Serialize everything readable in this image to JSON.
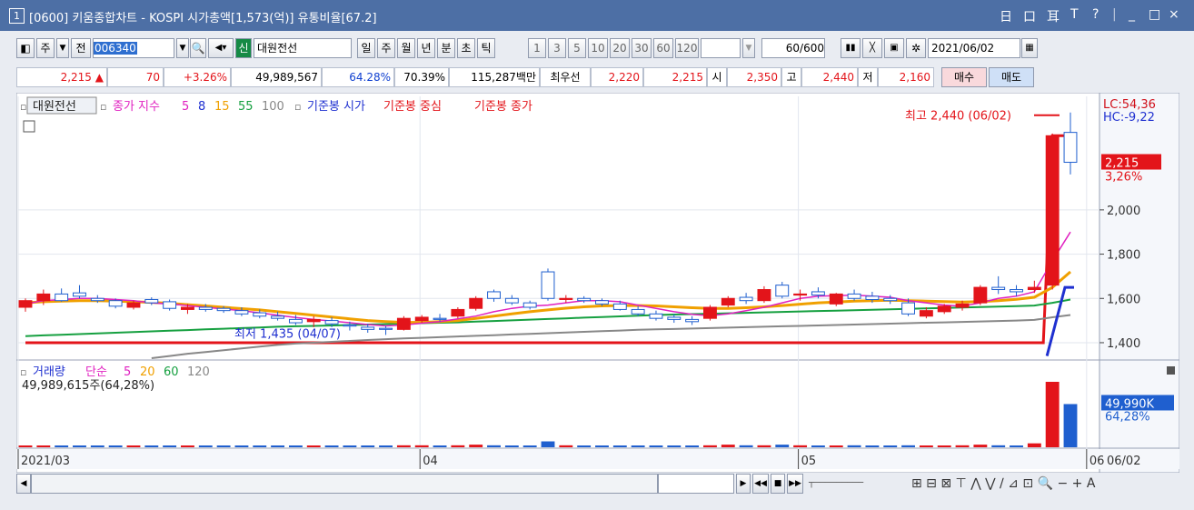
{
  "window": {
    "number": "1",
    "title": "[0600] 키움종합차트 - KOSPI 시가총액[1,573(억)] 유통비율[67.2]",
    "controls": [
      "日",
      "口",
      "耳",
      "T",
      "?",
      "|",
      "_",
      "□",
      "×"
    ]
  },
  "toolbar": {
    "market": "주",
    "prev": "전",
    "code": "006340",
    "new_badge": "신",
    "stock_name": "대원전선",
    "periods": [
      "일",
      "주",
      "월",
      "년",
      "분",
      "초",
      "틱"
    ],
    "active_period": "일",
    "intervals": [
      "1",
      "3",
      "5",
      "10",
      "20",
      "30",
      "60",
      "120"
    ],
    "count": "60",
    "total": "/600",
    "date": "2021/06/02"
  },
  "quote": {
    "price": "2,215",
    "up_mark": "▲",
    "change": "70",
    "change_pct": "+3.26%",
    "volume": "49,989,567",
    "vol_ratio": "64.28%",
    "turnover": "70.39%",
    "amount": "115,287백만",
    "bid_label": "최우선",
    "ask": "2,220",
    "bid": "2,215",
    "open_label": "시",
    "open": "2,350",
    "high_label": "고",
    "high": "2,440",
    "low_label": "저",
    "low": "2,160",
    "buy": "매수",
    "sell": "매도"
  },
  "legend": {
    "stock": "대원전선",
    "ma_label": "종가 지수",
    "ma_periods": [
      "5",
      "8",
      "15",
      "55",
      "100"
    ],
    "ref_open": "기준봉 시가",
    "ref_mid": "기준봉 중심",
    "ref_close": "기준봉 종가"
  },
  "vol_legend": {
    "label": "거래량",
    "type": "단순",
    "periods": [
      "5",
      "20",
      "60",
      "120"
    ],
    "value": "49,989,615주(64,28%)"
  },
  "annotations": {
    "high": "최고 2,440 (06/02)",
    "low": "최저 1,435 (04/07)"
  },
  "axis_right": {
    "lc": "LC:54,36",
    "hc": "HC:-9,22",
    "price_box": "2,215",
    "price_pct": "3,26%",
    "vol_box": "49,990K",
    "vol_pct": "64,28%"
  },
  "colors": {
    "up": "#e3141a",
    "down": "#1f5fcf",
    "ma5": "#e020c0",
    "ma8": "#1f30d0",
    "ma15": "#f0a000",
    "ma55": "#16a040",
    "ma100": "#888888",
    "ref_open": "#1f30d0",
    "ref_mid": "#e3141a",
    "ref_close": "#e3141a"
  },
  "chart_data": {
    "type": "candlestick",
    "y_ticks": [
      1400,
      1600,
      1800,
      2000
    ],
    "y_tick_labels": [
      "1,400",
      "1,600",
      "1,800",
      "2,000"
    ],
    "ylim": [
      1330,
      2480
    ],
    "x_labels": [
      {
        "label": "2021/03",
        "index": 0
      },
      {
        "label": "04",
        "index": 22
      },
      {
        "label": "05",
        "index": 43
      },
      {
        "label": "06",
        "index": 59
      }
    ],
    "last_date_label": "06/02",
    "candles": [
      [
        1560,
        1600,
        1540,
        1590
      ],
      [
        1590,
        1640,
        1570,
        1620
      ],
      [
        1620,
        1645,
        1585,
        1590
      ],
      [
        1625,
        1660,
        1600,
        1610
      ],
      [
        1600,
        1615,
        1580,
        1590
      ],
      [
        1590,
        1600,
        1555,
        1565
      ],
      [
        1560,
        1590,
        1550,
        1580
      ],
      [
        1595,
        1605,
        1570,
        1580
      ],
      [
        1585,
        1595,
        1545,
        1555
      ],
      [
        1550,
        1575,
        1530,
        1560
      ],
      [
        1560,
        1575,
        1540,
        1550
      ],
      [
        1555,
        1565,
        1535,
        1545
      ],
      [
        1545,
        1560,
        1520,
        1530
      ],
      [
        1535,
        1550,
        1510,
        1520
      ],
      [
        1520,
        1540,
        1500,
        1510
      ],
      [
        1505,
        1525,
        1480,
        1490
      ],
      [
        1495,
        1520,
        1470,
        1505
      ],
      [
        1500,
        1515,
        1470,
        1485
      ],
      [
        1480,
        1495,
        1455,
        1475
      ],
      [
        1470,
        1485,
        1445,
        1460
      ],
      [
        1465,
        1475,
        1435,
        1460
      ],
      [
        1460,
        1520,
        1455,
        1510
      ],
      [
        1500,
        1525,
        1490,
        1515
      ],
      [
        1510,
        1530,
        1495,
        1505
      ],
      [
        1520,
        1560,
        1510,
        1550
      ],
      [
        1555,
        1610,
        1545,
        1600
      ],
      [
        1630,
        1640,
        1585,
        1600
      ],
      [
        1600,
        1615,
        1570,
        1580
      ],
      [
        1580,
        1590,
        1550,
        1560
      ],
      [
        1720,
        1735,
        1590,
        1600
      ],
      [
        1595,
        1615,
        1580,
        1600
      ],
      [
        1600,
        1610,
        1580,
        1590
      ],
      [
        1590,
        1600,
        1565,
        1575
      ],
      [
        1575,
        1590,
        1545,
        1550
      ],
      [
        1550,
        1565,
        1520,
        1530
      ],
      [
        1530,
        1545,
        1500,
        1510
      ],
      [
        1515,
        1530,
        1490,
        1505
      ],
      [
        1505,
        1520,
        1480,
        1495
      ],
      [
        1510,
        1570,
        1500,
        1560
      ],
      [
        1570,
        1610,
        1560,
        1600
      ],
      [
        1605,
        1625,
        1575,
        1590
      ],
      [
        1590,
        1655,
        1580,
        1640
      ],
      [
        1660,
        1675,
        1600,
        1610
      ],
      [
        1615,
        1640,
        1590,
        1620
      ],
      [
        1630,
        1650,
        1600,
        1615
      ],
      [
        1575,
        1625,
        1565,
        1620
      ],
      [
        1620,
        1640,
        1590,
        1600
      ],
      [
        1610,
        1630,
        1580,
        1595
      ],
      [
        1600,
        1615,
        1575,
        1590
      ],
      [
        1580,
        1600,
        1520,
        1530
      ],
      [
        1520,
        1560,
        1510,
        1545
      ],
      [
        1540,
        1575,
        1530,
        1565
      ],
      [
        1560,
        1590,
        1545,
        1575
      ],
      [
        1580,
        1660,
        1570,
        1650
      ],
      [
        1650,
        1700,
        1620,
        1640
      ],
      [
        1640,
        1660,
        1610,
        1630
      ],
      [
        1640,
        1680,
        1625,
        1650
      ],
      [
        1660,
        2345,
        1640,
        2335
      ],
      [
        2350,
        2440,
        2160,
        2215
      ]
    ],
    "volumes": [
      0.02,
      0.02,
      0.02,
      0.02,
      0.02,
      0.02,
      0.02,
      0.02,
      0.02,
      0.02,
      0.02,
      0.02,
      0.02,
      0.02,
      0.02,
      0.02,
      0.02,
      0.02,
      0.02,
      0.02,
      0.02,
      0.03,
      0.03,
      0.02,
      0.03,
      0.04,
      0.03,
      0.02,
      0.02,
      0.09,
      0.03,
      0.02,
      0.02,
      0.02,
      0.02,
      0.02,
      0.02,
      0.02,
      0.03,
      0.04,
      0.03,
      0.03,
      0.04,
      0.03,
      0.02,
      0.02,
      0.03,
      0.02,
      0.02,
      0.03,
      0.02,
      0.02,
      0.03,
      0.04,
      0.03,
      0.02,
      0.06,
      1.0,
      0.66
    ],
    "volume_unit": "fraction of max",
    "ma5": [
      1575,
      1590,
      1595,
      1600,
      1600,
      1595,
      1590,
      1580,
      1575,
      1568,
      1560,
      1552,
      1545,
      1535,
      1524,
      1514,
      1505,
      1498,
      1490,
      1482,
      1476,
      1480,
      1488,
      1495,
      1508,
      1520,
      1540,
      1555,
      1565,
      1570,
      1580,
      1590,
      1590,
      1585,
      1570,
      1555,
      1540,
      1528,
      1522,
      1530,
      1545,
      1560,
      1580,
      1600,
      1610,
      1612,
      1615,
      1610,
      1605,
      1590,
      1580,
      1570,
      1565,
      1580,
      1600,
      1610,
      1630,
      1770,
      1900
    ],
    "ma15": [
      1580,
      1585,
      1588,
      1590,
      1590,
      1588,
      1585,
      1582,
      1578,
      1572,
      1566,
      1560,
      1554,
      1548,
      1540,
      1532,
      1524,
      1516,
      1508,
      1500,
      1495,
      1492,
      1492,
      1495,
      1500,
      1510,
      1520,
      1530,
      1540,
      1548,
      1556,
      1562,
      1566,
      1568,
      1568,
      1566,
      1562,
      1558,
      1555,
      1555,
      1558,
      1562,
      1568,
      1574,
      1580,
      1584,
      1588,
      1590,
      1592,
      1590,
      1588,
      1586,
      1584,
      1586,
      1590,
      1596,
      1605,
      1650,
      1720
    ],
    "ma55": [
      1430,
      1433,
      1436,
      1439,
      1442,
      1445,
      1448,
      1451,
      1454,
      1457,
      1460,
      1463,
      1466,
      1469,
      1472,
      1474,
      1476,
      1478,
      1480,
      1482,
      1484,
      1486,
      1488,
      1490,
      1492,
      1495,
      1498,
      1501,
      1504,
      1507,
      1510,
      1513,
      1516,
      1519,
      1522,
      1525,
      1527,
      1529,
      1531,
      1533,
      1535,
      1537,
      1539,
      1541,
      1543,
      1545,
      1547,
      1549,
      1551,
      1553,
      1555,
      1557,
      1559,
      1561,
      1563,
      1565,
      1568,
      1580,
      1595
    ],
    "ma100": [
      null,
      null,
      null,
      null,
      null,
      null,
      null,
      1330,
      1340,
      1350,
      1358,
      1366,
      1374,
      1382,
      1390,
      1396,
      1400,
      1404,
      1408,
      1412,
      1416,
      1419,
      1422,
      1425,
      1428,
      1431,
      1434,
      1437,
      1440,
      1443,
      1446,
      1449,
      1452,
      1455,
      1458,
      1460,
      1462,
      1464,
      1466,
      1468,
      1470,
      1472,
      1474,
      1476,
      1478,
      1480,
      1482,
      1484,
      1486,
      1488,
      1490,
      1492,
      1494,
      1496,
      1498,
      1500,
      1503,
      1515,
      1525
    ],
    "ref_close_level": 1400,
    "ref_close_to": 2335
  }
}
